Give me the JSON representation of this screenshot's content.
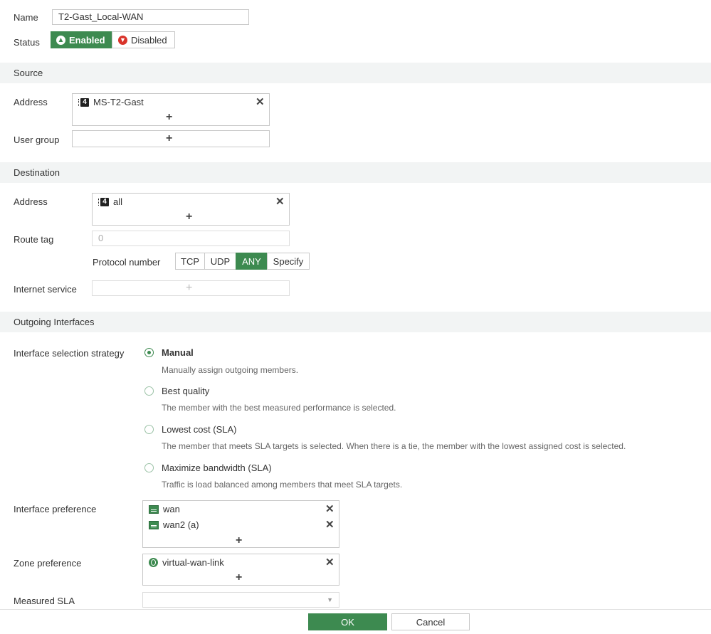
{
  "name": {
    "label": "Name",
    "value": "T2-Gast_Local-WAN"
  },
  "status": {
    "label": "Status",
    "enabled_label": "Enabled",
    "disabled_label": "Disabled"
  },
  "source": {
    "title": "Source",
    "address_label": "Address",
    "address_items": [
      "MS-T2-Gast"
    ],
    "user_group_label": "User group"
  },
  "destination": {
    "title": "Destination",
    "address_label": "Address",
    "address_items": [
      "all"
    ],
    "route_tag_label": "Route tag",
    "route_tag_placeholder": "0",
    "protocol_label": "Protocol number",
    "protocol_options": [
      "TCP",
      "UDP",
      "ANY",
      "Specify"
    ],
    "protocol_selected": "ANY",
    "internet_service_label": "Internet service"
  },
  "outgoing": {
    "title": "Outgoing Interfaces",
    "strategy_label": "Interface selection strategy",
    "options": [
      {
        "title": "Manual",
        "desc": "Manually assign outgoing members."
      },
      {
        "title": "Best quality",
        "desc": "The member with the best measured performance is selected."
      },
      {
        "title": "Lowest cost (SLA)",
        "desc": "The member that meets SLA targets is selected. When there is a tie, the member with the lowest assigned cost is selected."
      },
      {
        "title": "Maximize bandwidth (SLA)",
        "desc": "Traffic is load balanced among members that meet SLA targets."
      }
    ],
    "selected_option": "Manual",
    "interface_pref_label": "Interface preference",
    "interface_items": [
      "wan",
      "wan2 (a)"
    ],
    "zone_pref_label": "Zone preference",
    "zone_items": [
      "virtual-wan-link"
    ],
    "measured_sla_label": "Measured SLA"
  },
  "footer": {
    "ok_label": "OK",
    "cancel_label": "Cancel"
  },
  "colors": {
    "accent": "#3d8a50",
    "disabled_red": "#d9342b",
    "section_bg": "#f2f4f4"
  }
}
